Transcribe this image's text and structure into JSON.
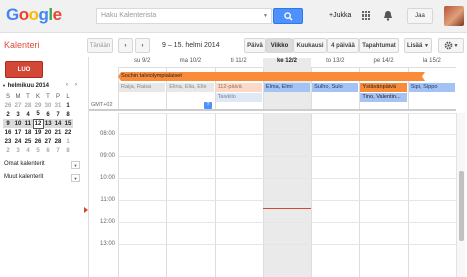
{
  "header": {
    "logo": "Google",
    "search_placeholder": "Haku Kalenterista",
    "user_link": "+Jukka",
    "share_label": "Jaa"
  },
  "toolbar": {
    "app_title": "Kalenteri",
    "today": "Tänään",
    "date_range": "9 – 15. helmi 2014",
    "views": [
      "Päivä",
      "Viikko",
      "Kuukausi",
      "4 päivää",
      "Tapahtumat"
    ],
    "active_view": "Viikko",
    "more": "Lisää"
  },
  "sidebar": {
    "create": "LUO",
    "mini_month": "helmikuu 2014",
    "weekday_heads": [
      "S",
      "M",
      "T",
      "K",
      "T",
      "P",
      "L"
    ],
    "weeks": [
      [
        "26",
        "27",
        "28",
        "29",
        "30",
        "31",
        "1"
      ],
      [
        "2",
        "3",
        "4",
        "5",
        "6",
        "7",
        "8"
      ],
      [
        "9",
        "10",
        "11",
        "12",
        "13",
        "14",
        "15"
      ],
      [
        "16",
        "17",
        "18",
        "19",
        "20",
        "21",
        "22"
      ],
      [
        "23",
        "24",
        "25",
        "26",
        "27",
        "28",
        "1"
      ],
      [
        "2",
        "3",
        "4",
        "5",
        "6",
        "7",
        "8"
      ]
    ],
    "my_calendars": "Omat kalenterit",
    "other_calendars": "Muut kalenterit"
  },
  "grid": {
    "timezone": "GMT+02",
    "days": [
      "su 9/2",
      "ma 10/2",
      "ti 11/2",
      "ke 12/2",
      "to 13/2",
      "pe 14/2",
      "la 15/2"
    ],
    "today_index": 3,
    "hours": [
      "08:00",
      "09:00",
      "10:00",
      "11:00",
      "12:00",
      "13:00"
    ],
    "multi_day_event": "Sochin talviolympialaiset",
    "allday_events": [
      {
        "text": "Raija, Raisa",
        "day": 0
      },
      {
        "text": "Elina, Ella, Elle",
        "day": 1
      },
      {
        "text": "112-päivä",
        "day": 2
      },
      {
        "text": "Elma, Elmi",
        "day": 3
      },
      {
        "text": "Sulho, Sulo",
        "day": 4
      },
      {
        "text": "Ystävänpäivä",
        "day": 5
      },
      {
        "text": "Sipi, Sippo",
        "day": 6
      },
      {
        "text": "Taivkilo",
        "day": 2
      },
      {
        "text": "Tino, Valentin...",
        "day": 5
      }
    ],
    "more_badge": "?"
  },
  "colors": {
    "accent_red": "#d14836",
    "search_blue": "#4d90fe",
    "event_orange": "#f88c3a",
    "event_blue": "#a4c2f4",
    "event_peach": "#fad9c8",
    "today_bg": "#eaeaea"
  }
}
